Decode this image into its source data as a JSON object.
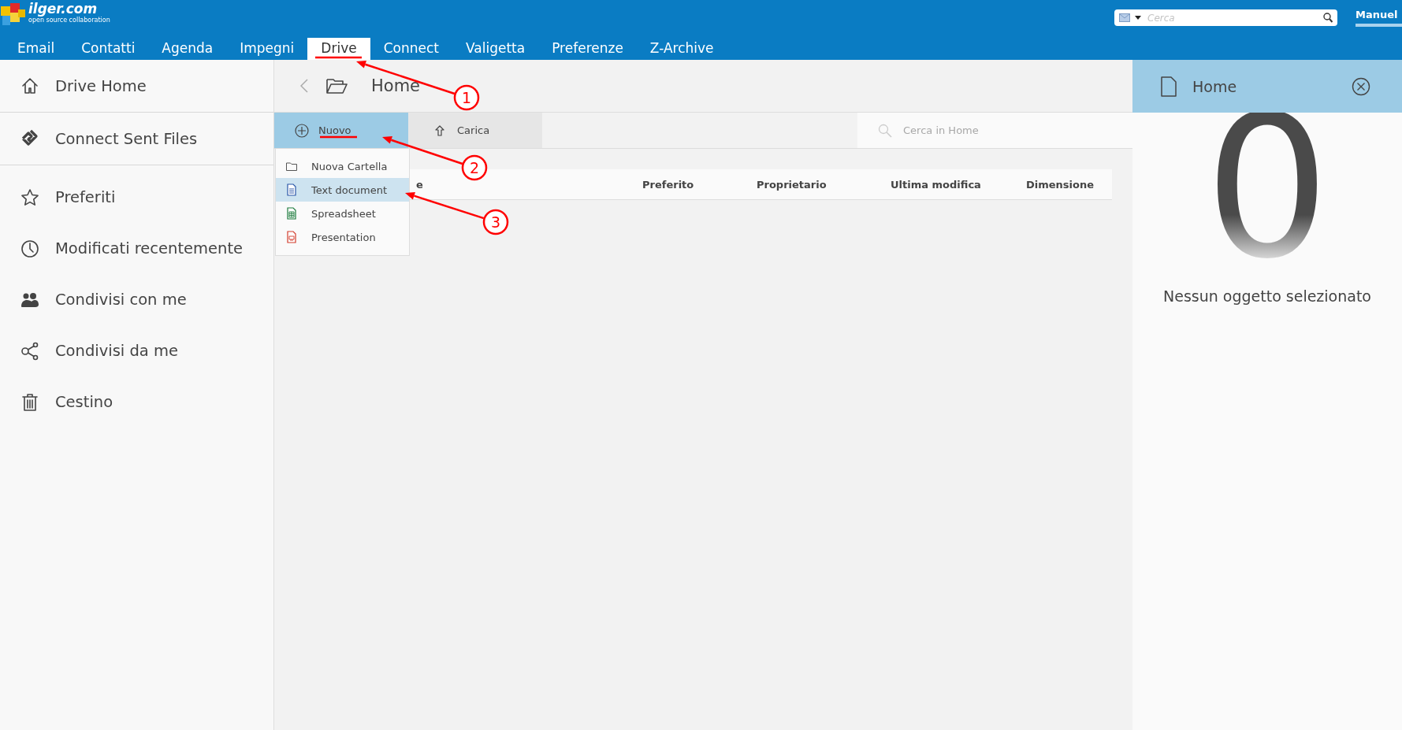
{
  "logo": {
    "name": "ilger.com",
    "tagline": "open source collaboration"
  },
  "nav": [
    {
      "label": "Email",
      "selected": false
    },
    {
      "label": "Contatti",
      "selected": false
    },
    {
      "label": "Agenda",
      "selected": false
    },
    {
      "label": "Impegni",
      "selected": false
    },
    {
      "label": "Drive",
      "selected": true
    },
    {
      "label": "Connect",
      "selected": false
    },
    {
      "label": "Valigetta",
      "selected": false
    },
    {
      "label": "Preferenze",
      "selected": false
    },
    {
      "label": "Z-Archive",
      "selected": false
    }
  ],
  "global_search": {
    "placeholder": "Cerca"
  },
  "user": "Manuel",
  "sidebar": {
    "groups": [
      {
        "items": [
          "Drive Home"
        ]
      },
      {
        "items": [
          "Connect Sent Files"
        ]
      },
      {
        "items": [
          "Preferiti",
          "Modificati recentemente",
          "Condivisi con me",
          "Condivisi da me",
          "Cestino"
        ]
      }
    ]
  },
  "breadcrumb": {
    "title": "Home"
  },
  "toolbar": {
    "buttons": [
      {
        "label": "Nuovo",
        "selected": true
      },
      {
        "label": "Carica",
        "selected": false
      }
    ],
    "search": {
      "placeholder": "Cerca in Home"
    }
  },
  "table": {
    "columns": [
      "e",
      "Preferito",
      "Proprietario",
      "Ultima modifica",
      "Dimensione"
    ]
  },
  "new_menu": {
    "items": [
      {
        "label": "Nuova Cartella",
        "selected": false
      },
      {
        "label": "Text document",
        "selected": true
      },
      {
        "label": "Spreadsheet",
        "selected": false
      },
      {
        "label": "Presentation",
        "selected": false
      }
    ]
  },
  "details": {
    "title": "Home",
    "count": "0",
    "message": "Nessun oggetto selezionato"
  },
  "annotations": [
    {
      "label": "1"
    },
    {
      "label": "2"
    },
    {
      "label": "3"
    }
  ]
}
